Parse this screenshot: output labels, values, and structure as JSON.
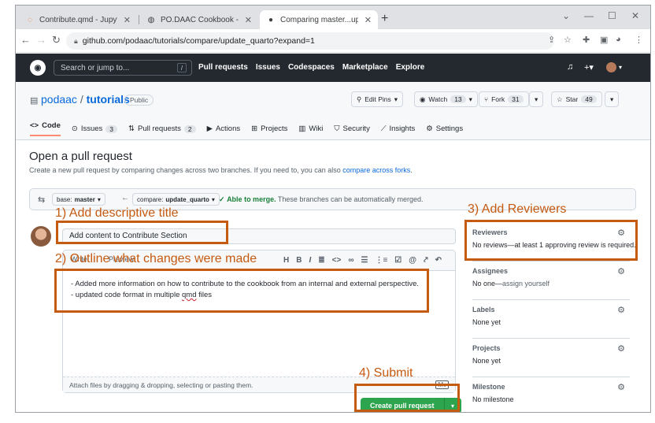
{
  "browser": {
    "tabs": [
      {
        "title": "Contribute.qmd - JupyterLab",
        "icon": "jupyter-icon"
      },
      {
        "title": "PO.DAAC Cookbook - Contribute",
        "icon": "globe-icon"
      },
      {
        "title": "Comparing master...update_quar",
        "icon": "github-icon"
      }
    ],
    "url": "github.com/podaac/tutorials/compare/update_quarto?expand=1"
  },
  "github": {
    "search_placeholder": "Search or jump to...",
    "search_key": "/",
    "nav": [
      "Pull requests",
      "Issues",
      "Codespaces",
      "Marketplace",
      "Explore"
    ]
  },
  "repo": {
    "owner": "podaac",
    "separator": "/",
    "name": "tutorials",
    "visibility": "Public",
    "edit_pins": "Edit Pins",
    "watch": {
      "label": "Watch",
      "count": "13"
    },
    "fork": {
      "label": "Fork",
      "count": "31"
    },
    "star": {
      "label": "Star",
      "count": "49"
    },
    "tabs": [
      {
        "label": "Code"
      },
      {
        "label": "Issues",
        "count": "3"
      },
      {
        "label": "Pull requests",
        "count": "2"
      },
      {
        "label": "Actions"
      },
      {
        "label": "Projects"
      },
      {
        "label": "Wiki"
      },
      {
        "label": "Security"
      },
      {
        "label": "Insights"
      },
      {
        "label": "Settings"
      }
    ]
  },
  "page": {
    "title": "Open a pull request",
    "subtitle": "Create a new pull request by comparing changes across two branches. If you need to, you can also",
    "subtitle_link": "compare across forks",
    "subtitle_end": "."
  },
  "compare": {
    "base_prefix": "base:",
    "base": "master",
    "compare_prefix": "compare:",
    "compare": "update_quarto",
    "merge_status": "Able to merge.",
    "merge_note": "These branches can be automatically merged."
  },
  "pr": {
    "title_value": "Add content to Contribute Section",
    "write_tab": "Write",
    "preview_tab": "Preview",
    "body_line1": "- Added more information on how to contribute to the cookbook from an internal and external perspective.",
    "body_line2_pre": "- updated code format in multiple ",
    "body_line2_word": "qmd",
    "body_line2_post": " files",
    "attach_hint": "Attach files by dragging & dropping, selecting or pasting them.",
    "markdown_badge": "M↓",
    "create_button": "Create pull request"
  },
  "sidebar": [
    {
      "heading": "Reviewers",
      "value": "No reviews—at least 1 approving review is required."
    },
    {
      "heading": "Assignees",
      "value": "No one—",
      "link": "assign yourself"
    },
    {
      "heading": "Labels",
      "value": "None yet"
    },
    {
      "heading": "Projects",
      "value": "None yet"
    },
    {
      "heading": "Milestone",
      "value": "No milestone"
    }
  ],
  "annotations": {
    "title": "1) Add descriptive title",
    "outline": "2) Outline what changes were made",
    "reviewers": "3) Add Reviewers",
    "submit": "4) Submit",
    "color": "#c55a11"
  }
}
